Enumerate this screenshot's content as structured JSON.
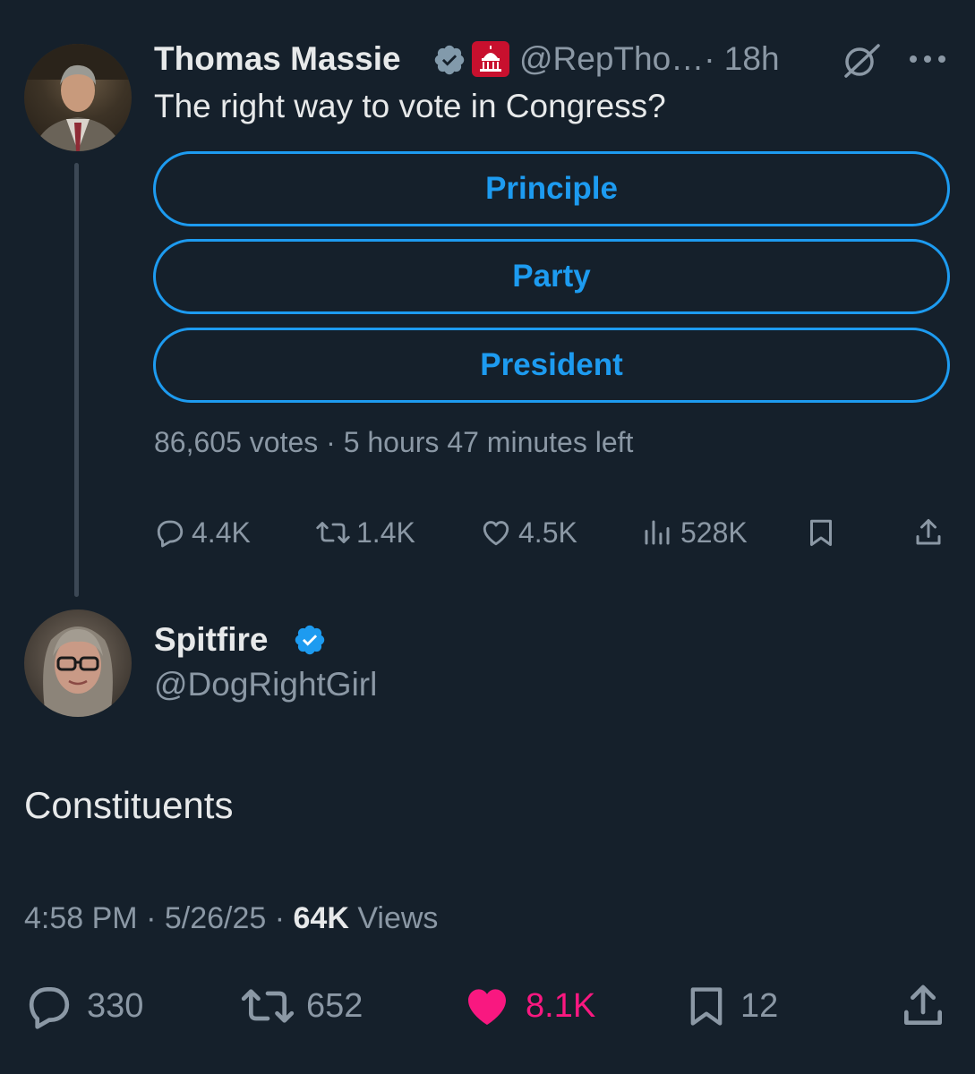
{
  "colors": {
    "background": "#15202b",
    "text": "#e7e9ea",
    "muted": "#8b98a5",
    "accent": "#1d9bf0",
    "like_active": "#f91880",
    "gov_badge": "#c8102e"
  },
  "tweet1": {
    "author": {
      "name": "Thomas Massie",
      "handle": "@RepTho…",
      "time": "· 18h",
      "verified_icon": "verified-gray-badge-icon",
      "affiliation_icon": "us-capitol-badge-icon"
    },
    "text": "The right way to vote in Congress?",
    "poll": {
      "options": [
        "Principle",
        "Party",
        "President"
      ],
      "meta": "86,605 votes · 5 hours 47 minutes left"
    },
    "actions": {
      "replies": "4.4K",
      "retweets": "1.4K",
      "likes": "4.5K",
      "views": "528K"
    }
  },
  "tweet2": {
    "author": {
      "name": "Spitfire",
      "handle": "@DogRightGirl",
      "verified_icon": "verified-blue-badge-icon"
    },
    "text": "Constituents",
    "meta": {
      "time": "4:58 PM",
      "sep1": " · ",
      "date": "5/26/25",
      "sep2": " · ",
      "views_count": "64K",
      "views_label": " Views"
    },
    "actions": {
      "replies": "330",
      "retweets": "652",
      "likes": "8.1K",
      "bookmarks": "12"
    }
  }
}
